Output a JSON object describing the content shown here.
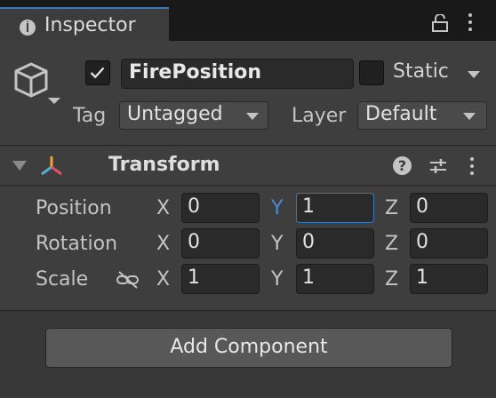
{
  "tab": {
    "title": "Inspector",
    "icon": "info-icon"
  },
  "header": {
    "active_checked": true,
    "object_name": "FirePosition",
    "static_label": "Static",
    "static_checked": false,
    "tag_label": "Tag",
    "tag_value": "Untagged",
    "layer_label": "Layer",
    "layer_value": "Default"
  },
  "transform": {
    "title": "Transform",
    "help_symbol": "?",
    "rows": [
      {
        "label": "Position",
        "x": "0",
        "y": "1",
        "z": "0"
      },
      {
        "label": "Rotation",
        "x": "0",
        "y": "0",
        "z": "0"
      },
      {
        "label": "Scale",
        "x": "1",
        "y": "1",
        "z": "1"
      }
    ],
    "axis_x": "X",
    "axis_y": "Y",
    "axis_z": "Z"
  },
  "add_component_label": "Add Component",
  "colors": {
    "accent": "#3a79bb",
    "active_axis": "#4d8ad1",
    "panel": "#3e3e3e",
    "tab_bar": "#191919"
  }
}
